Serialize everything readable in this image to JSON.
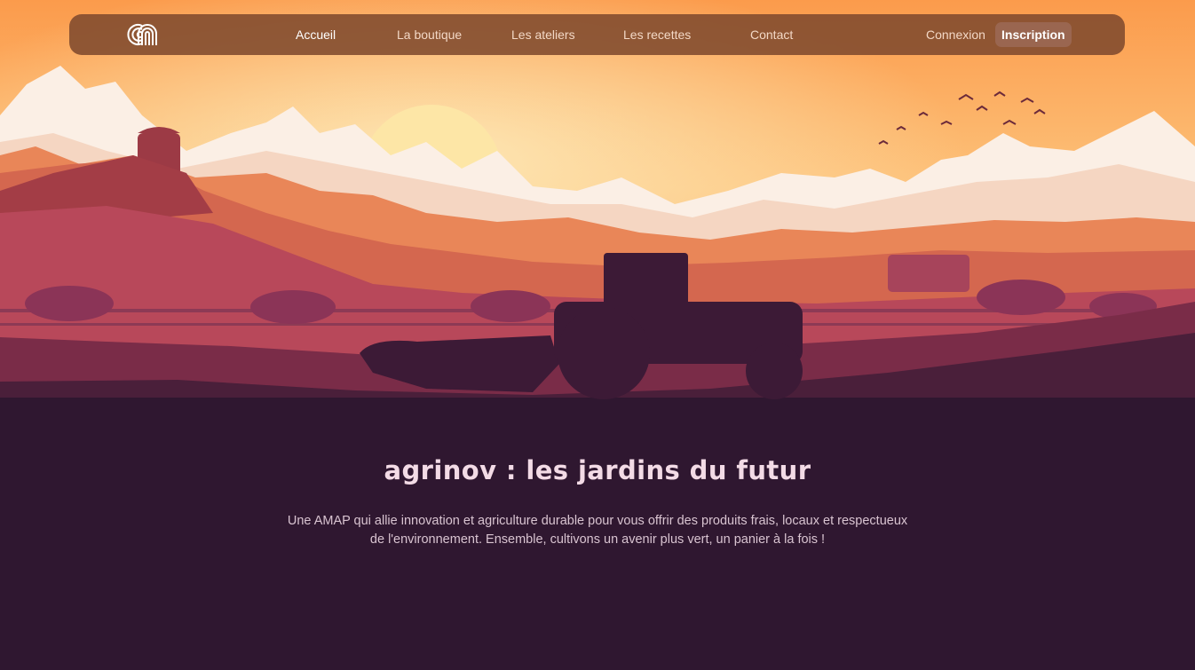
{
  "nav": {
    "logo_icon": "agrinov-logo-icon",
    "links": [
      {
        "label": "Accueil",
        "active": true
      },
      {
        "label": "La boutique",
        "active": false
      },
      {
        "label": "Les ateliers",
        "active": false
      },
      {
        "label": "Les recettes",
        "active": false
      },
      {
        "label": "Contact",
        "active": false
      }
    ],
    "login_label": "Connexion",
    "signup_label": "Inscription"
  },
  "hero": {
    "illustration": "farm-sunset-tractor-illustration"
  },
  "main": {
    "title": "agrinov : les jardins du futur",
    "description": "Une AMAP qui allie innovation et agriculture durable pour vous offrir des produits frais, locaux et respectueux de l'environnement. Ensemble, cultivons un avenir plus vert, un panier à la fois !"
  },
  "colors": {
    "sky_top": "#fb9b4c",
    "sky_glow": "#fde0a0",
    "nav_bg": "#804a2e",
    "signup_bg": "#9a6650",
    "page_bg": "#2f1730"
  }
}
